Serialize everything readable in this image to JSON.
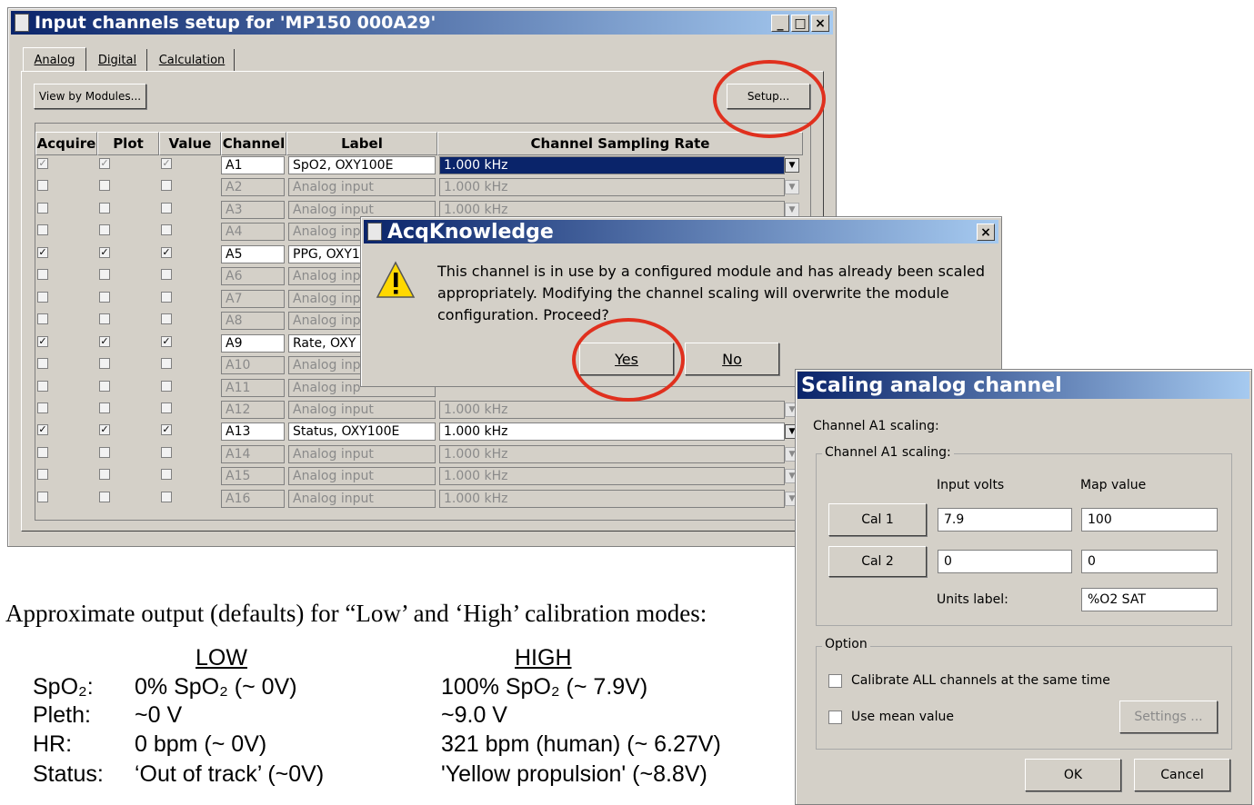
{
  "input_dialog": {
    "title": "Input channels setup for 'MP150 000A29'",
    "min": "_",
    "max": "□",
    "close": "×",
    "tabs": [
      "Analog",
      "Digital",
      "Calculation"
    ],
    "view_by_modules": "View by Modules...",
    "setup": "Setup...",
    "columns": [
      "Acquire",
      "Plot",
      "Value",
      "Channel",
      "Label",
      "Channel Sampling Rate"
    ],
    "rows": [
      {
        "channel": "A1",
        "label": "SpO2, OXY100E",
        "rate": "1.000 kHz",
        "acquire": true,
        "plot": true,
        "value": true,
        "state": "selected"
      },
      {
        "channel": "A2",
        "label": "Analog input",
        "rate": "1.000 kHz",
        "acquire": false,
        "plot": false,
        "value": false,
        "state": "disabled"
      },
      {
        "channel": "A3",
        "label": "Analog input",
        "rate": "1.000 kHz",
        "acquire": false,
        "plot": false,
        "value": false,
        "state": "disabled"
      },
      {
        "channel": "A4",
        "label": "Analog inp",
        "rate": "",
        "acquire": false,
        "plot": false,
        "value": false,
        "state": "disabled"
      },
      {
        "channel": "A5",
        "label": "PPG, OXY1",
        "rate": "",
        "acquire": true,
        "plot": true,
        "value": true,
        "state": "enabled"
      },
      {
        "channel": "A6",
        "label": "Analog inp",
        "rate": "",
        "acquire": false,
        "plot": false,
        "value": false,
        "state": "disabled"
      },
      {
        "channel": "A7",
        "label": "Analog inp",
        "rate": "",
        "acquire": false,
        "plot": false,
        "value": false,
        "state": "disabled"
      },
      {
        "channel": "A8",
        "label": "Analog inp",
        "rate": "",
        "acquire": false,
        "plot": false,
        "value": false,
        "state": "disabled"
      },
      {
        "channel": "A9",
        "label": "Rate, OXY",
        "rate": "",
        "acquire": true,
        "plot": true,
        "value": true,
        "state": "enabled"
      },
      {
        "channel": "A10",
        "label": "Analog inp",
        "rate": "",
        "acquire": false,
        "plot": false,
        "value": false,
        "state": "disabled"
      },
      {
        "channel": "A11",
        "label": "Analog inp",
        "rate": "",
        "acquire": false,
        "plot": false,
        "value": false,
        "state": "disabled"
      },
      {
        "channel": "A12",
        "label": "Analog input",
        "rate": "1.000 kHz",
        "acquire": false,
        "plot": false,
        "value": false,
        "state": "disabled"
      },
      {
        "channel": "A13",
        "label": "Status, OXY100E",
        "rate": "1.000 kHz",
        "acquire": true,
        "plot": true,
        "value": true,
        "state": "enabled"
      },
      {
        "channel": "A14",
        "label": "Analog input",
        "rate": "1.000 kHz",
        "acquire": false,
        "plot": false,
        "value": false,
        "state": "disabled"
      },
      {
        "channel": "A15",
        "label": "Analog input",
        "rate": "1.000 kHz",
        "acquire": false,
        "plot": false,
        "value": false,
        "state": "disabled"
      },
      {
        "channel": "A16",
        "label": "Analog input",
        "rate": "1.000 kHz",
        "acquire": false,
        "plot": false,
        "value": false,
        "state": "disabled"
      }
    ]
  },
  "acq_dialog": {
    "title": "AcqKnowledge",
    "close": "×",
    "message_lines": [
      "This channel is in use by a configured module and has already been scaled",
      "appropriately.   Modifying the channel scaling will overwrite the module",
      "configuration.   Proceed?"
    ],
    "yes": "Yes",
    "no": "No"
  },
  "scaling_dialog": {
    "title": "Scaling analog channel",
    "heading": "Channel A1 scaling:",
    "group_label": "Channel A1 scaling:",
    "input_volts_label": "Input volts",
    "map_value_label": "Map value",
    "cal1": "Cal 1",
    "cal2": "Cal 2",
    "cal1_input": "7.9",
    "cal1_map": "100",
    "cal2_input": "0",
    "cal2_map": "0",
    "units_label": "Units label:",
    "units_value": "%O2 SAT",
    "option_label": "Option",
    "calibrate_all": "Calibrate ALL channels at the same time",
    "use_mean": "Use mean value",
    "settings": "Settings ...",
    "ok": "OK",
    "cancel": "Cancel"
  },
  "doc": {
    "heading": "Approximate output (defaults) for “Low’ and ‘High’ calibration modes:",
    "low_header": "LOW",
    "high_header": "HIGH",
    "rows": [
      {
        "name": "SpO₂:",
        "low": "0% SpO₂  (~ 0V)",
        "high": "100% SpO₂  (~ 7.9V)"
      },
      {
        "name": "Pleth:",
        "low": "~0 V",
        "high": " ~9.0 V"
      },
      {
        "name": "HR:",
        "low": "0 bpm   (~ 0V)",
        "high": "321 bpm (human)    (~ 6.27V)"
      },
      {
        "name": "Status:",
        "low": "‘Out of track’   (~0V)",
        "high": "'Yellow   propulsion'   (~8.8V)"
      }
    ]
  },
  "colors": {
    "highlight_circle": "#e0301e",
    "title_start": "#0a246a",
    "title_end": "#a6caf0"
  }
}
